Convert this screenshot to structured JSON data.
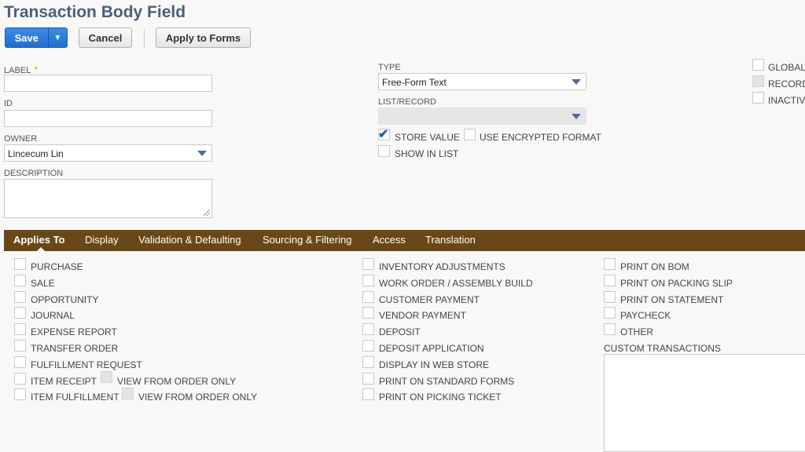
{
  "page": {
    "title": "Transaction Body Field"
  },
  "toolbar": {
    "save": "Save",
    "save_menu": "▼",
    "cancel": "Cancel",
    "apply_to_forms": "Apply to Forms"
  },
  "fields": {
    "label": {
      "label": "LABEL",
      "required": "*",
      "value": ""
    },
    "id": {
      "label": "ID",
      "value": ""
    },
    "owner": {
      "label": "OWNER",
      "value": "Lincecum Lin"
    },
    "description": {
      "label": "DESCRIPTION",
      "value": ""
    },
    "type": {
      "label": "TYPE",
      "value": "Free-Form Text"
    },
    "list_record": {
      "label": "LIST/RECORD",
      "value": ""
    }
  },
  "options": {
    "store_value": {
      "label": "STORE VALUE",
      "checked": true
    },
    "use_encrypted_format": {
      "label": "USE ENCRYPTED FORMAT",
      "checked": false
    },
    "show_in_list": {
      "label": "SHOW IN LIST",
      "checked": false
    },
    "global": {
      "label": "GLOBAL",
      "checked": false
    },
    "record": {
      "label": "RECORD",
      "checked": false,
      "disabled": true
    },
    "inactive": {
      "label": "INACTIV",
      "checked": false
    }
  },
  "tabs": [
    {
      "label": "Applies To",
      "active": true
    },
    {
      "label": "Display"
    },
    {
      "label": "Validation & Defaulting"
    },
    {
      "label": "Sourcing & Filtering"
    },
    {
      "label": "Access"
    },
    {
      "label": "Translation"
    }
  ],
  "applies_to": {
    "col1": [
      "PURCHASE",
      "SALE",
      "OPPORTUNITY",
      "JOURNAL",
      "EXPENSE REPORT",
      "TRANSFER ORDER",
      "FULFILLMENT REQUEST",
      "ITEM RECEIPT",
      "ITEM FULFILLMENT"
    ],
    "view_from_order_only": "VIEW FROM ORDER ONLY",
    "col2": [
      "INVENTORY ADJUSTMENTS",
      "WORK ORDER / ASSEMBLY BUILD",
      "CUSTOMER PAYMENT",
      "VENDOR PAYMENT",
      "DEPOSIT",
      "DEPOSIT APPLICATION",
      "DISPLAY IN WEB STORE",
      "PRINT ON STANDARD FORMS",
      "PRINT ON PICKING TICKET"
    ],
    "col3": [
      "PRINT ON BOM",
      "PRINT ON PACKING SLIP",
      "PRINT ON STATEMENT",
      "PAYCHECK",
      "OTHER"
    ],
    "custom_transactions": "CUSTOM TRANSACTIONS"
  }
}
